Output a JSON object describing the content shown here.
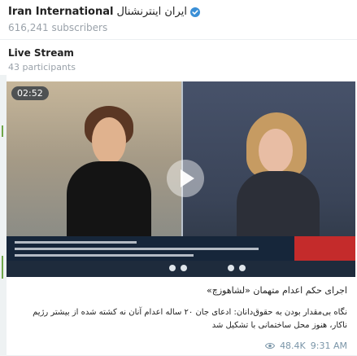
{
  "channel": {
    "name": "Iran International",
    "name_fa": "ایران اینترنشنال",
    "subscribers": "616,241 subscribers"
  },
  "live": {
    "title": "Live Stream",
    "participants": "43 participants"
  },
  "video": {
    "timer": "02:52"
  },
  "post": {
    "headline": "اجرای حکم اعدام متهمان «لشاهوزچ»",
    "body": "نگاه بی‌مقدار بودن به حقوق‌دانان: ادعای جان ۲۰ ساله اعدام آنان نه کشته شده از بیشتر رژیم ناکار، هنوز محل ساختمانی با تشکیل شد",
    "views": "48.4K",
    "time": "9:31 AM"
  },
  "colors": {
    "accent": "#3a8fd6",
    "live_mark": "#6fa64a",
    "meta": "#7a95a8"
  },
  "icons": {
    "verified": "verified-badge-icon",
    "play": "play-icon",
    "views": "eye-icon"
  }
}
